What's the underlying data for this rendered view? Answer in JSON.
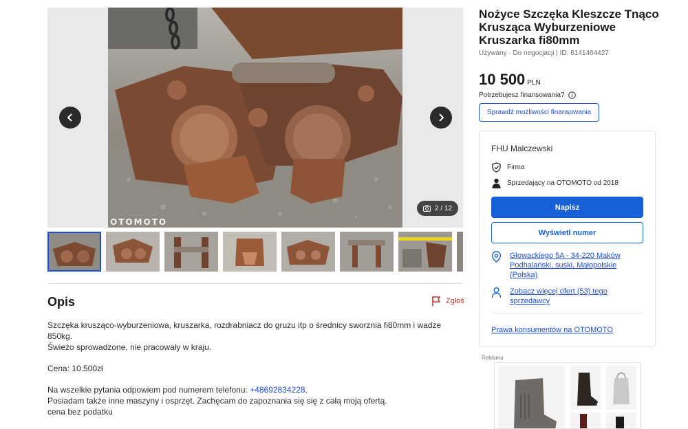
{
  "listing": {
    "title": "Nożyce Szczęka Kleszcze Tnąco Krusząca Wyburzeniowe Kruszarka fi80mm",
    "meta": "Używany · Do negocjacji | ID: 6141464427",
    "price": "10 500",
    "currency": "PLN",
    "financing_question": "Potrzebujesz finansowania?",
    "financing_button": "Sprawdź możliwości finansowania"
  },
  "gallery": {
    "watermark": "OTOMOTO",
    "counter": "2 / 12",
    "thumbnail_count": 8,
    "active_thumbnail": 1
  },
  "description": {
    "heading": "Opis",
    "report_label": "Zgłoś",
    "line1": "Szczęka krusząco-wyburzeniowa, kruszarka, rozdrabniacz do gruzu itp o średnicy sworznia fi80mm i wadze 850kg.",
    "line2": "Świeżo sprowadzone, nie pracowały w kraju.",
    "price_line": "Cena: 10.500zł",
    "phone_intro": "Na wszelkie pytania odpowiem pod numerem telefonu: ",
    "phone": "+48692834228",
    "phone_suffix": ".",
    "line_offer": "Posiadam także inne maszyny i osprzęt. Zachęcam do zapoznania się się z całą moją ofertą.",
    "line_tax": "cena bez podatku"
  },
  "seller": {
    "name": "FHU Malczewski",
    "type": "Firma",
    "since": "Sprzedający na OTOMOTO od 2018",
    "write_button": "Napisz",
    "show_number_button": "Wyświetl numer",
    "address": "Głowackiego 5A - 34-220 Maków Podhalański, suski, Małopolskie (Polska)",
    "more_offers": "Zobacz więcej ofert (53) tego sprzedawcy",
    "consumer_rights": "Prawa konsumentów na OTOMOTO"
  },
  "ad": {
    "label": "Reklama"
  },
  "colors": {
    "accent": "#1860d8",
    "report": "#c0392b"
  }
}
